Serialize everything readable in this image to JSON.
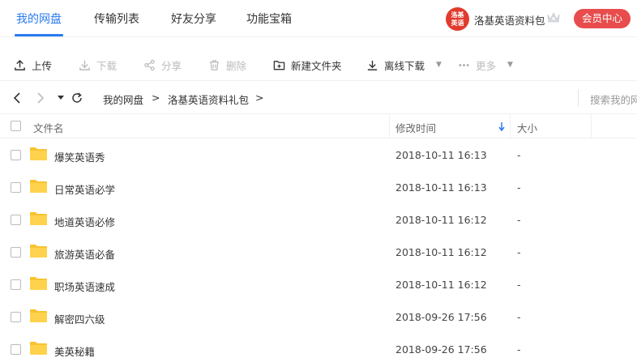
{
  "nav": {
    "tabs": [
      {
        "label": "我的网盘"
      },
      {
        "label": "传输列表"
      },
      {
        "label": "好友分享"
      },
      {
        "label": "功能宝箱"
      }
    ],
    "avatar_text": "洛基英语",
    "username": "洛基英语资料包",
    "vip_button": "会员中心"
  },
  "toolbar": {
    "upload": "上传",
    "download": "下载",
    "share": "分享",
    "delete": "删除",
    "new_folder": "新建文件夹",
    "offline_download": "离线下载",
    "more": "更多"
  },
  "breadcrumb": {
    "root": "我的网盘",
    "sep1": ">",
    "current": "洛基英语资料礼包",
    "sep2": ">",
    "search_placeholder": "搜索我的网盘文件"
  },
  "table": {
    "headers": {
      "name": "文件名",
      "modified": "修改时间",
      "size": "大小"
    },
    "rows": [
      {
        "name": "爆笑英语秀",
        "modified": "2018-10-11 16:13",
        "size": "-"
      },
      {
        "name": "日常英语必学",
        "modified": "2018-10-11 16:13",
        "size": "-"
      },
      {
        "name": "地道英语必修",
        "modified": "2018-10-11 16:12",
        "size": "-"
      },
      {
        "name": "旅游英语必备",
        "modified": "2018-10-11 16:12",
        "size": "-"
      },
      {
        "name": "职场英语速成",
        "modified": "2018-10-11 16:12",
        "size": "-"
      },
      {
        "name": "解密四六级",
        "modified": "2018-09-26 17:56",
        "size": "-"
      },
      {
        "name": "美英秘籍",
        "modified": "2018-09-26 17:56",
        "size": "-"
      }
    ]
  },
  "colors": {
    "accent": "#2b7bf0",
    "vip": "#e84c4c",
    "folder": "#f7c331"
  }
}
